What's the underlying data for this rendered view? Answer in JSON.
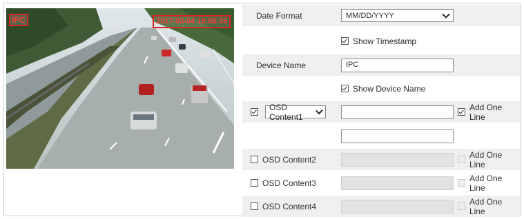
{
  "preview": {
    "osd_name_text": "IPC",
    "osd_time_text": "2017-03-04 15:58:35"
  },
  "settings": {
    "date_format": {
      "label": "Date Format",
      "value": "MM/DD/YYYY"
    },
    "show_timestamp": {
      "label": "Show Timestamp",
      "checked": true
    },
    "device_name": {
      "label": "Device Name",
      "value": "IPC"
    },
    "show_device_name": {
      "label": "Show Device Name",
      "checked": true
    },
    "osd1": {
      "select_value": "OSD Content1",
      "checked": true,
      "text": "",
      "add_one_line": "Add One Line",
      "add_checked": true,
      "second_line": ""
    },
    "osd2": {
      "label": "OSD Content2",
      "checked": false,
      "add_one_line": "Add One Line"
    },
    "osd3": {
      "label": "OSD Content3",
      "checked": false,
      "add_one_line": "Add One Line"
    },
    "osd4": {
      "label": "OSD Content4",
      "checked": false,
      "add_one_line": "Add One Line"
    }
  },
  "colors": {
    "osd_red": "#e02424",
    "row_shade": "#efefef"
  }
}
